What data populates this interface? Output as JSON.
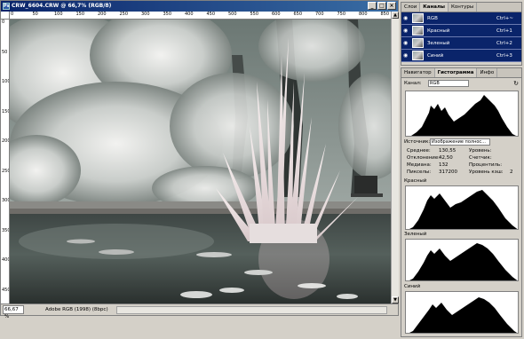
{
  "document": {
    "title": "CRW_6604.CRW @ 66,7% (RGB/8)",
    "zoom": "66,67 %",
    "profile": "Adobe RGB (1998) (8bpc)",
    "ruler_h_labels": [
      "0",
      "50",
      "100",
      "150",
      "200",
      "250",
      "300",
      "350",
      "400",
      "450",
      "500",
      "550",
      "600",
      "650",
      "700",
      "750",
      "800",
      "850"
    ],
    "ruler_v_labels": [
      "0",
      "50",
      "100",
      "150",
      "200",
      "250",
      "300",
      "350",
      "400",
      "450"
    ]
  },
  "channels_panel": {
    "tabs": [
      "Слои",
      "Каналы",
      "Контуры"
    ],
    "channels": [
      {
        "name": "RGB",
        "shortcut": "Ctrl+~"
      },
      {
        "name": "Красный",
        "shortcut": "Ctrl+1"
      },
      {
        "name": "Зеленый",
        "shortcut": "Ctrl+2"
      },
      {
        "name": "Синий",
        "shortcut": "Ctrl+3"
      }
    ]
  },
  "histogram_panel": {
    "tabs": [
      "Навигатор",
      "Гистограмма",
      "Инфо"
    ],
    "channel_label": "Канал:",
    "channel_value": "RGB",
    "source_label": "Источник:",
    "source_value": "Изображение полнос...",
    "stats": {
      "mean_label": "Среднее:",
      "mean": "130,55",
      "stddev_label": "Отклонение:",
      "stddev": "42,50",
      "median_label": "Медиана:",
      "median": "132",
      "pixels_label": "Пикселы:",
      "pixels": "317200",
      "level_label": "Уровень:",
      "level": "",
      "count_label": "Счетчик:",
      "count": "",
      "percentile_label": "Процентиль:",
      "percentile": "",
      "cache_label": "Уровень кэш:",
      "cache": "2"
    },
    "red_label": "Красный",
    "green_label": "Зеленый",
    "blue_label": "Синий"
  },
  "colors": {
    "selection": "#0a246a",
    "title_bar": "#0a246a"
  }
}
